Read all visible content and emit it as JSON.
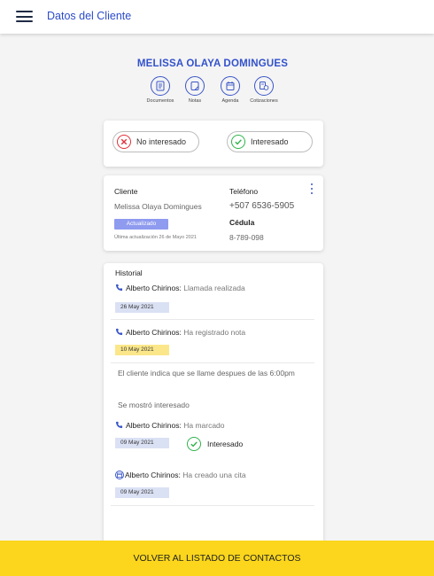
{
  "header": {
    "title": "Datos del Cliente",
    "menu_icon": "hamburger-menu-icon"
  },
  "client": {
    "name": "MELISSA OLAYA DOMINGUES"
  },
  "actions": [
    {
      "label": "Documentos",
      "icon": "document-icon"
    },
    {
      "label": "Notas",
      "icon": "notes-icon"
    },
    {
      "label": "Agenda",
      "icon": "calendar-icon"
    },
    {
      "label": "Cotizaciones",
      "icon": "quote-icon"
    }
  ],
  "interest": {
    "not_interested": "No interesado",
    "interested": "Interesado"
  },
  "info": {
    "client_label": "Cliente",
    "client_name": "Melissa Olaya Domingues",
    "status_badge": "Actualizado",
    "last_update": "Última actualización 26 de Mayo 2021",
    "phone_label": "Teléfono",
    "phone": "+507 6536-5905",
    "id_label": "Cédula",
    "id_number": "8-789-098"
  },
  "history": {
    "title": "Historial",
    "entries": [
      {
        "agent": "Alberto Chirinos:",
        "action": "Llamada realizada",
        "date": "26 May 2021"
      },
      {
        "agent": "Alberto Chirinos:",
        "action": "Ha registrado nota",
        "date": "10 May 2021",
        "note_1": "El cliente indica que se llame despues de las 6:00pm",
        "note_2": "Se mostró interesado"
      },
      {
        "agent": "Alberto Chirinos:",
        "action": "Ha marcado",
        "date": "09 May 2021",
        "status": "Interesado"
      },
      {
        "agent": "Alberto Chirinos:",
        "action": "Ha creado una cita",
        "date": "09 May 2021"
      }
    ]
  },
  "footer": {
    "back_button": "VOLVER AL LISTADO DE CONTACTOS"
  },
  "colors": {
    "brand_blue": "#3352cc",
    "accent_yellow": "#fbd61c",
    "success_green": "#2eb34a",
    "danger_red": "#e0303a"
  }
}
